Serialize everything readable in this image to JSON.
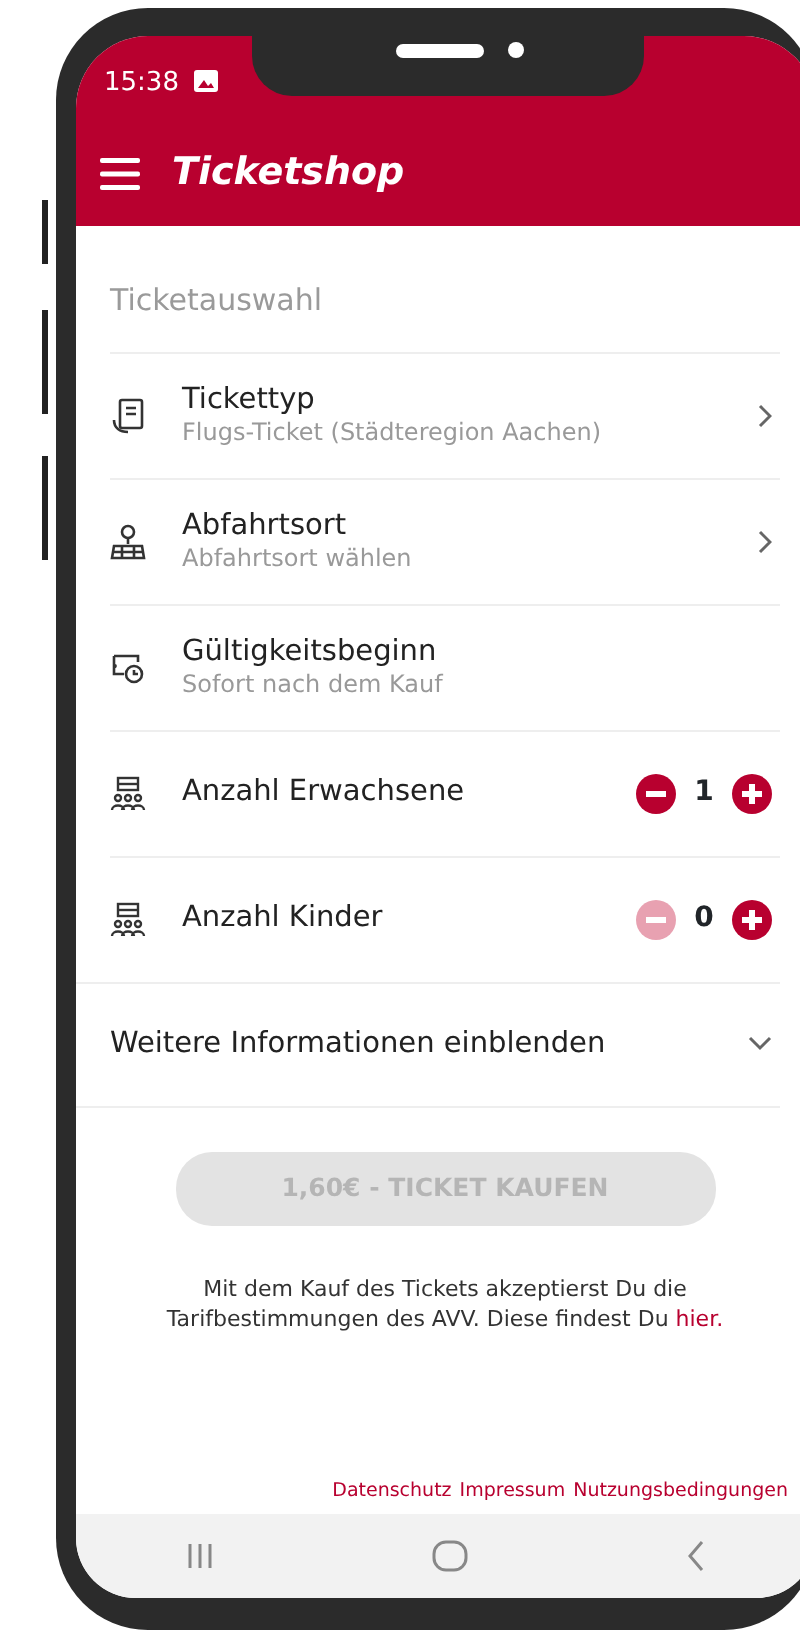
{
  "status_bar": {
    "time": "15:38"
  },
  "app_bar": {
    "title": "Ticketshop"
  },
  "section_title": "Ticketauswahl",
  "rows": [
    {
      "kind": "select",
      "title": "Tickettyp",
      "subtitle": "Flugs-Ticket (Städteregion Aachen)"
    },
    {
      "kind": "select",
      "title": "Abfahrtsort",
      "subtitle": "Abfahrtsort wählen"
    },
    {
      "kind": "info",
      "title": "Gültigkeitsbeginn",
      "subtitle": "Sofort nach dem Kauf"
    },
    {
      "kind": "counter",
      "title": "Anzahl Erwachsene",
      "value": "1",
      "minus_disabled": false
    },
    {
      "kind": "counter",
      "title": "Anzahl Kinder",
      "value": "0",
      "minus_disabled": true
    }
  ],
  "expander": {
    "label": "Weitere Informationen einblenden",
    "expanded": false
  },
  "buy_button": {
    "label": "1,60€ - TICKET KAUFEN",
    "disabled": true
  },
  "terms": {
    "text": "Mit dem Kauf des Tickets akzeptierst Du die Tarifbestimmungen des AVV. Diese findest Du ",
    "link": "hier."
  },
  "footer_links": [
    "Datenschutz",
    "Impressum",
    "Nutzungsbedingungen"
  ]
}
